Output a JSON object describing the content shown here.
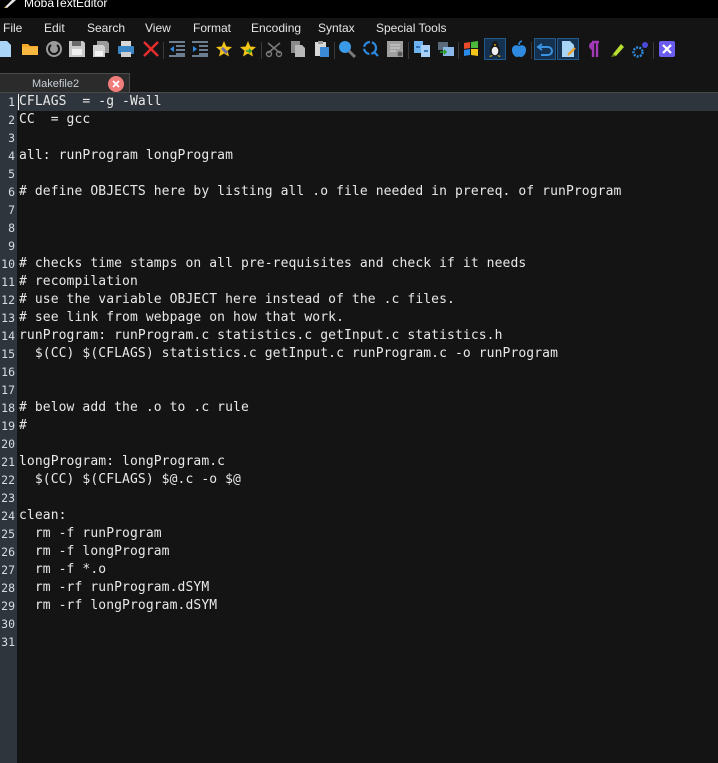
{
  "window": {
    "title": "MobaTextEditor"
  },
  "menu": {
    "items": [
      "File",
      "Edit",
      "Search",
      "View",
      "Format",
      "Encoding",
      "Syntax",
      "Special Tools"
    ]
  },
  "toolbar": {
    "buttons": [
      {
        "icon": "new-file-icon"
      },
      {
        "icon": "open-folder-icon"
      },
      {
        "icon": "reload-icon"
      },
      {
        "icon": "save-icon"
      },
      {
        "icon": "save-all-icon"
      },
      {
        "icon": "print-icon"
      },
      {
        "icon": "close-file-icon"
      },
      {
        "icon": "unindent-icon"
      },
      {
        "icon": "indent-icon"
      },
      {
        "icon": "bookmark-add-icon"
      },
      {
        "icon": "bookmark-next-icon"
      },
      {
        "icon": "cut-icon"
      },
      {
        "icon": "copy-icon"
      },
      {
        "icon": "paste-icon"
      },
      {
        "icon": "search-icon"
      },
      {
        "icon": "replace-icon"
      },
      {
        "icon": "goto-line-icon"
      },
      {
        "icon": "compare-icon"
      },
      {
        "icon": "move-icon"
      },
      {
        "icon": "windows-eol-icon"
      },
      {
        "icon": "linux-eol-icon",
        "active": true
      },
      {
        "icon": "mac-eol-icon"
      },
      {
        "icon": "word-wrap-icon",
        "active": true
      },
      {
        "icon": "edit-mode-icon",
        "active": true
      },
      {
        "icon": "show-all-chars-icon"
      },
      {
        "icon": "highlight-icon"
      },
      {
        "icon": "settings-icon"
      },
      {
        "icon": "exit-icon"
      }
    ]
  },
  "tabs": [
    {
      "label": "Makefile2",
      "active": true
    }
  ],
  "editor": {
    "current_line": 1,
    "lines": [
      "CFLAGS  = -g -Wall",
      "CC  = gcc",
      "",
      "all: runProgram longProgram",
      "",
      "# define OBJECTS here by listing all .o file needed in prereq. of runProgram",
      "",
      "",
      "",
      "# checks time stamps on all pre-requisites and check if it needs",
      "# recompilation",
      "# use the variable OBJECT here instead of the .c files.",
      "# see link from webpage on how that work.",
      "runProgram: runProgram.c statistics.c getInput.c statistics.h",
      "  $(CC) $(CFLAGS) statistics.c getInput.c runProgram.c -o runProgram",
      "",
      "",
      "# below add the .o to .c rule",
      "#",
      "",
      "longProgram: longProgram.c",
      "  $(CC) $(CFLAGS) $@.c -o $@",
      "",
      "clean:",
      "  rm -f runProgram",
      "  rm -f longProgram",
      "  rm -f *.o",
      "  rm -rf runProgram.dSYM",
      "  rm -rf longProgram.dSYM",
      "",
      ""
    ],
    "line_numbers": [
      "1",
      "2",
      "3",
      "4",
      "5",
      "6",
      "7",
      "8",
      "9",
      "10",
      "11",
      "12",
      "13",
      "14",
      "15",
      "16",
      "17",
      "18",
      "19",
      "20",
      "21",
      "22",
      "23",
      "24",
      "25",
      "26",
      "27",
      "28",
      "29",
      "30",
      "31"
    ]
  }
}
